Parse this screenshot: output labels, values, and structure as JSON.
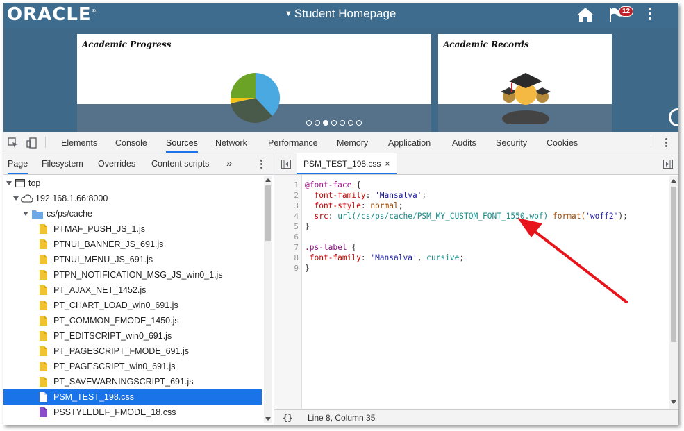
{
  "oracle": {
    "logo": "ORACLE",
    "page_title": "Student Homepage",
    "notification_count": "12",
    "tiles": [
      {
        "title": "Academic Progress"
      },
      {
        "title": "Academic Records"
      }
    ],
    "carousel": {
      "total": 7,
      "active_index": 2
    }
  },
  "devtools": {
    "panels": [
      "Elements",
      "Console",
      "Sources",
      "Network",
      "Performance",
      "Memory",
      "Application",
      "Audits",
      "Security",
      "Cookies"
    ],
    "active_panel": "Sources",
    "navigator_tabs": [
      "Page",
      "Filesystem",
      "Overrides",
      "Content scripts"
    ],
    "more_tabs": "»",
    "tree": [
      {
        "label": "top",
        "level": 0,
        "type": "frame"
      },
      {
        "label": "192.168.1.66:8000",
        "level": 1,
        "type": "domain"
      },
      {
        "label": "cs/ps/cache",
        "level": 2,
        "type": "folder"
      },
      {
        "label": "PTMAF_PUSH_JS_1.js",
        "level": 3,
        "type": "js"
      },
      {
        "label": "PTNUI_BANNER_JS_691.js",
        "level": 3,
        "type": "js"
      },
      {
        "label": "PTNUI_MENU_JS_691.js",
        "level": 3,
        "type": "js"
      },
      {
        "label": "PTPN_NOTIFICATION_MSG_JS_win0_1.js",
        "level": 3,
        "type": "js"
      },
      {
        "label": "PT_AJAX_NET_1452.js",
        "level": 3,
        "type": "js"
      },
      {
        "label": "PT_CHART_LOAD_win0_691.js",
        "level": 3,
        "type": "js"
      },
      {
        "label": "PT_COMMON_FMODE_1450.js",
        "level": 3,
        "type": "js"
      },
      {
        "label": "PT_EDITSCRIPT_win0_691.js",
        "level": 3,
        "type": "js"
      },
      {
        "label": "PT_PAGESCRIPT_FMODE_691.js",
        "level": 3,
        "type": "js"
      },
      {
        "label": "PT_PAGESCRIPT_win0_691.js",
        "level": 3,
        "type": "js"
      },
      {
        "label": "PT_SAVEWARNINGSCRIPT_691.js",
        "level": 3,
        "type": "js"
      },
      {
        "label": "PSM_TEST_198.css",
        "level": 3,
        "type": "css",
        "selected": true
      },
      {
        "label": "PSSTYLEDEF_FMODE_18.css",
        "level": 3,
        "type": "css2"
      }
    ],
    "editor": {
      "file_tab": "PSM_TEST_198.css",
      "close": "×",
      "line_numbers": [
        "1",
        "2",
        "3",
        "4",
        "5",
        "6",
        "7",
        "8",
        "9"
      ],
      "status_icon": "{}",
      "status": "Line 8, Column 35",
      "code": {
        "l1_at": "@font-face",
        "l1_brace": " {",
        "l2_prop": "font-family",
        "l2_val": "'Mansalva'",
        "l3_prop": "font-style",
        "l3_val": "normal",
        "l4_prop": "src",
        "l4_url": "url(/cs/ps/cache/PSM_MY_CUSTOM_FONT_1550.wof)",
        "l4_fmt": "format(",
        "l4_fmtval": "'woff2'",
        "l4_end": ");",
        "l5": "}",
        "l7_sel": ".ps-label",
        "l7_brace": " {",
        "l8_prop": "font-family",
        "l8_val1": "'Mansalva'",
        "l8_val2": "cursive",
        "l9": "}"
      }
    },
    "colors": {
      "accent": "#1a73e8",
      "annotation": "#e8141b",
      "oracle_bar": "#3d6c8e"
    }
  }
}
